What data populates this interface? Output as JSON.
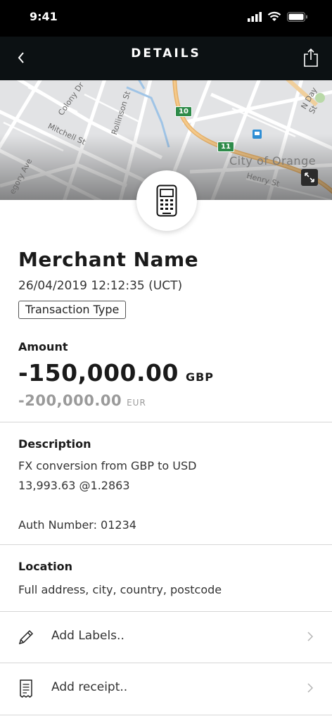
{
  "status_bar": {
    "time": "9:41"
  },
  "nav": {
    "title": "DETAILS",
    "back_icon": "chevron-left-icon",
    "share_icon": "share-icon"
  },
  "map": {
    "street_labels": [
      "Colony Dr",
      "Mitchell St",
      "Rollinson St",
      "N Day St",
      "Henry St",
      "egory Ave"
    ],
    "route_labels": [
      "10",
      "11"
    ],
    "city_label": "City of Orange",
    "expand_icon": "expand-icon"
  },
  "merchant": {
    "name": "Merchant Name",
    "datetime": "26/04/2019  12:12:35 (UCT)",
    "transaction_type": "Transaction Type",
    "icon": "card-terminal-icon"
  },
  "amount": {
    "label": "Amount",
    "primary_value": "-150,000.00",
    "primary_currency": "GBP",
    "secondary_value": "-200,000.00",
    "secondary_currency": "EUR"
  },
  "description": {
    "label": "Description",
    "line1": "FX conversion from GBP to USD",
    "line2": "13,993.63 @1.2863",
    "auth": "Auth Number: 01234"
  },
  "location": {
    "label": "Location",
    "address": "Full address, city, country, postcode"
  },
  "actions": [
    {
      "label": "Add Labels..",
      "icon": "pencil-icon"
    },
    {
      "label": "Add receipt..",
      "icon": "receipt-icon"
    }
  ],
  "colors": {
    "nav_bg": "#0c1113",
    "divider": "#d6d6d6",
    "secondary_text": "#9a9a9a",
    "map_route": "#2e8b4a"
  }
}
